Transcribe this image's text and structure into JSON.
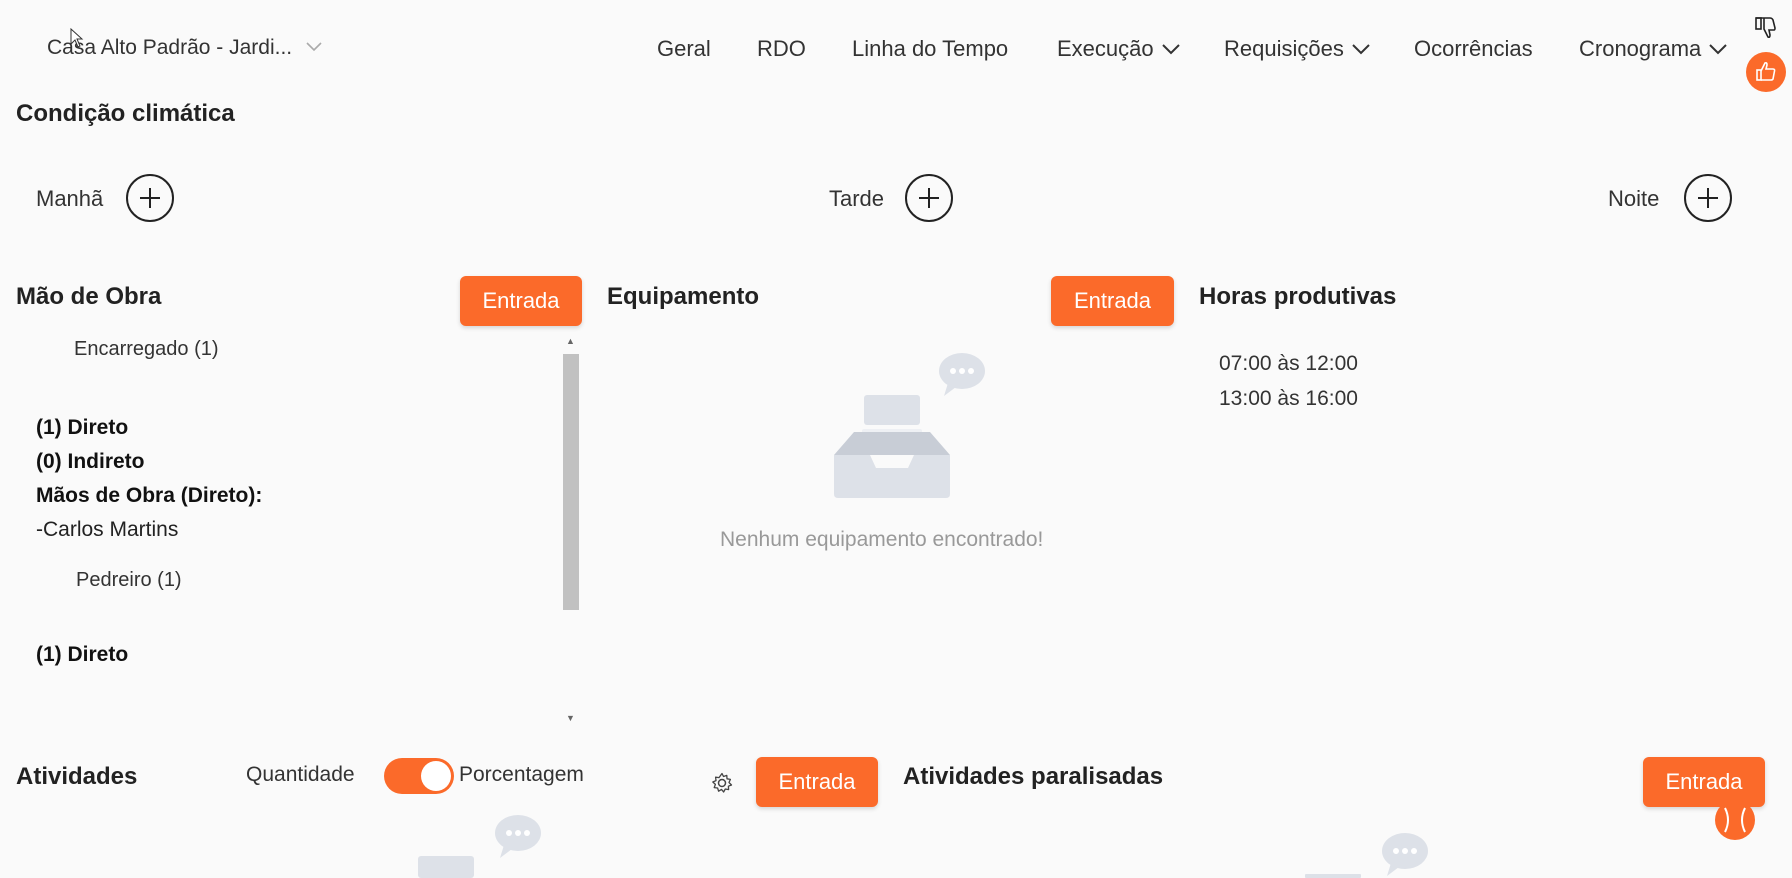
{
  "header": {
    "project_name": "Casa Alto Padrão - Jardi...",
    "nav": [
      {
        "label": "Geral"
      },
      {
        "label": "RDO"
      },
      {
        "label": "Linha do Tempo"
      },
      {
        "label": "Execução"
      },
      {
        "label": "Requisições"
      },
      {
        "label": "Ocorrências"
      },
      {
        "label": "Cronograma"
      }
    ]
  },
  "weather": {
    "title": "Condição climática",
    "periods": [
      {
        "label": "Manhã"
      },
      {
        "label": "Tarde"
      },
      {
        "label": "Noite"
      }
    ]
  },
  "labor": {
    "title": "Mão de Obra",
    "button": "Entrada",
    "roles": [
      {
        "role": "Encarregado (1)",
        "direct": "(1) Direto",
        "indirect": "(0) Indireto",
        "direct_header": "Mãos de Obra (Direto):",
        "workers": [
          "-Carlos Martins"
        ]
      },
      {
        "role": "Pedreiro (1)",
        "direct": "(1) Direto"
      }
    ]
  },
  "equipment": {
    "title": "Equipamento",
    "button": "Entrada",
    "empty_message": "Nenhum equipamento encontrado!"
  },
  "productive_hours": {
    "title": "Horas produtivas",
    "ranges": [
      "07:00 às 12:00",
      "13:00 às 16:00"
    ]
  },
  "activities": {
    "title": "Atividades",
    "toggle_left": "Quantidade",
    "toggle_right": "Porcentagem",
    "toggle_state": "Porcentagem",
    "button": "Entrada"
  },
  "paused_activities": {
    "title": "Atividades paralisadas",
    "button": "Entrada"
  },
  "colors": {
    "accent": "#fb6a2a",
    "scroll_thumb": "#c1c1c1",
    "empty_icon": "#dde1e8"
  }
}
